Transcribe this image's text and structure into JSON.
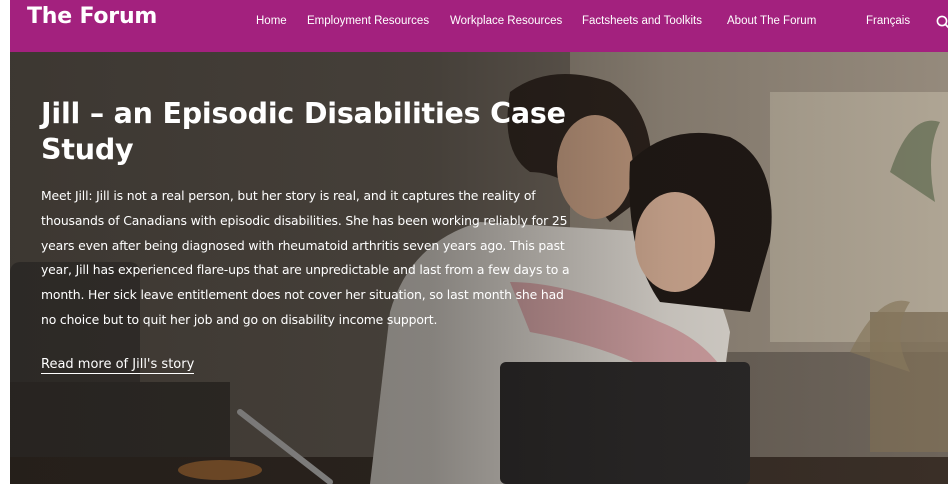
{
  "header": {
    "logo": "The Forum",
    "nav": [
      {
        "label": "Home"
      },
      {
        "label": "Employment Resources"
      },
      {
        "label": "Workplace Resources"
      },
      {
        "label": "Factsheets and Toolkits"
      },
      {
        "label": "About The Forum"
      }
    ],
    "language": "Français",
    "search_icon": "search-icon",
    "background": "#a3217e"
  },
  "hero": {
    "title": "Jill – an Episodic Disabilities Case Study",
    "body": "Meet Jill: Jill is not a real person, but her story is real, and it captures the reality of thousands of Canadians with episodic disabilities. She has been working reliably for 25 years even after being diagnosed with rheumatoid arthritis seven years ago. This past year, Jill has experienced flare-ups that are unpredictable and last from a few days to a month. Her sick leave entitlement does not cover her situation, so last month she had no choice but to quit her job and go on disability income support.",
    "link": "Read more of Jill's story"
  }
}
